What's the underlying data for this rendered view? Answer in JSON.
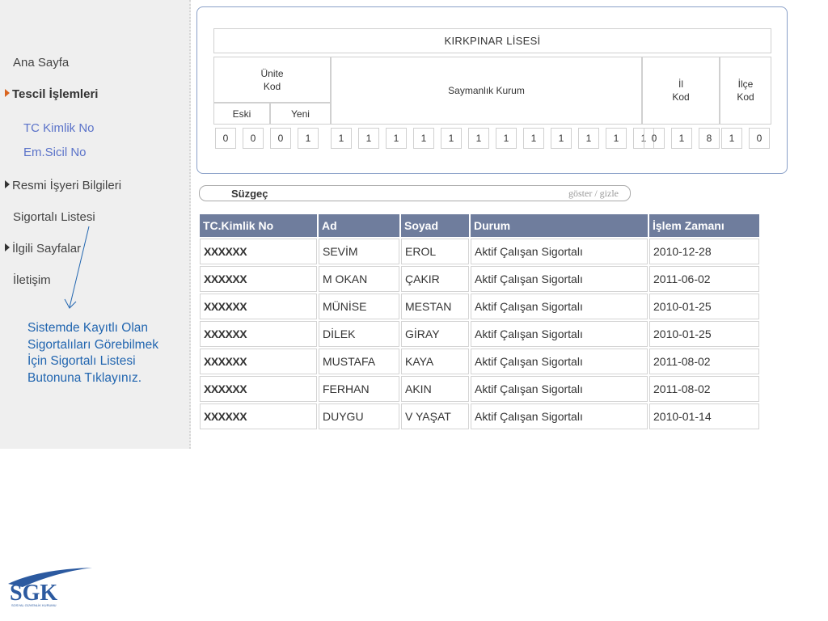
{
  "sidebar": {
    "items": [
      {
        "label": "Ana Sayfa"
      },
      {
        "label": "Tescil İşlemleri"
      },
      {
        "label": "TC Kimlik No"
      },
      {
        "label": "Em.Sicil No"
      },
      {
        "label": "Resmi İşyeri Bilgileri"
      },
      {
        "label": "Sigortalı Listesi"
      },
      {
        "label": "İlgili Sayfalar"
      },
      {
        "label": "İletişim"
      }
    ]
  },
  "annotation": "Sistemde Kayıtlı Olan Sigortalıları Görebilmek İçin Sigortalı Listesi Butonuna Tıklayınız.",
  "header": {
    "school": "KIRKPINAR LİSESİ",
    "unite": "Ünite",
    "kod": "Kod",
    "eski": "Eski",
    "yeni": "Yeni",
    "saymanlik": "Saymanlık Kurum",
    "il": "İl",
    "il_kod": "Kod",
    "ilce": "İlçe",
    "ilce_kod": "Kod",
    "digits": [
      "0",
      "0",
      "0",
      "1",
      "1",
      "1",
      "1",
      "1",
      "1",
      "1",
      "1",
      "1",
      "1",
      "1",
      "1",
      "1",
      "0",
      "1",
      "8",
      "1",
      "0"
    ]
  },
  "filter": {
    "label": "Süzgeç",
    "toggle": "göster / gizle"
  },
  "table": {
    "columns": [
      "TC.Kimlik No",
      "Ad",
      "Soyad",
      "Durum",
      "İşlem Zamanı"
    ],
    "rows": [
      {
        "tc": "XXXXXX",
        "ad": "SEVİM",
        "soyad": "EROL",
        "durum": "Aktif Çalışan Sigortalı",
        "zaman": "2010-12-28"
      },
      {
        "tc": "XXXXXX",
        "ad": "M OKAN",
        "soyad": "ÇAKIR",
        "durum": "Aktif Çalışan Sigortalı",
        "zaman": "2011-06-02"
      },
      {
        "tc": "XXXXXX",
        "ad": "MÜNİSE",
        "soyad": "MESTAN",
        "durum": "Aktif Çalışan Sigortalı",
        "zaman": "2010-01-25"
      },
      {
        "tc": "XXXXXX",
        "ad": "DİLEK",
        "soyad": "GİRAY",
        "durum": "Aktif Çalışan Sigortalı",
        "zaman": "2010-01-25"
      },
      {
        "tc": "XXXXXX",
        "ad": "MUSTAFA",
        "soyad": "KAYA",
        "durum": "Aktif Çalışan Sigortalı",
        "zaman": "2011-08-02"
      },
      {
        "tc": "XXXXXX",
        "ad": "FERHAN",
        "soyad": "AKIN",
        "durum": "Aktif Çalışan Sigortalı",
        "zaman": "2011-08-02"
      },
      {
        "tc": "XXXXXX",
        "ad": "DUYGU",
        "soyad": "V YAŞAT",
        "durum": "Aktif Çalışan Sigortalı",
        "zaman": "2010-01-14"
      }
    ]
  },
  "logo": {
    "text": "SGK",
    "subtext": "SOSYAL GÜVENLİK KURUMU"
  },
  "colors": {
    "header_bg": "#6f7d9d",
    "accent_orange": "#d9641f",
    "link_blue": "#5b73c9",
    "annotation_blue": "#2266b0"
  }
}
